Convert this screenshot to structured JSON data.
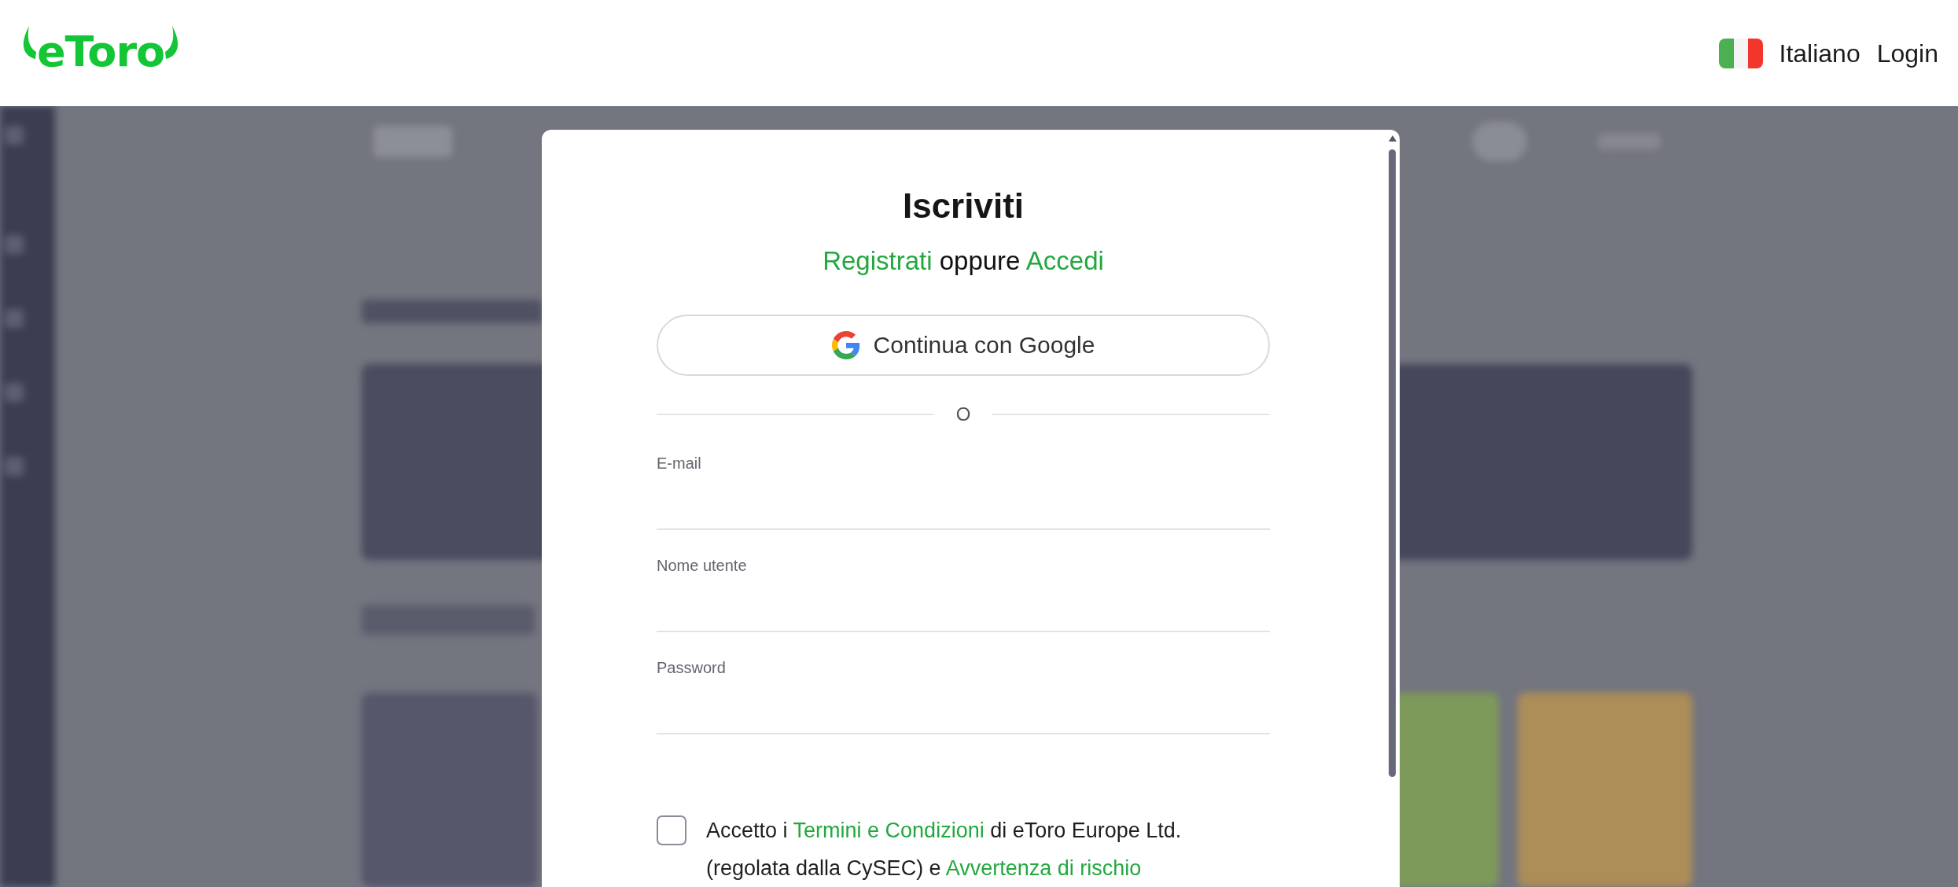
{
  "header": {
    "logo": "eToro",
    "language": "Italiano",
    "login": "Login"
  },
  "modal": {
    "title": "Iscriviti",
    "subtitle": [
      {
        "kind": "link",
        "text": "Registrati"
      },
      {
        "kind": "text",
        "text": " oppure "
      },
      {
        "kind": "link",
        "text": "Accedi"
      }
    ],
    "google_button": "Continua con Google",
    "divider": "O",
    "fields": [
      {
        "label": "E-mail"
      },
      {
        "label": "Nome utente"
      },
      {
        "label": "Password"
      }
    ],
    "consent": {
      "checked": false,
      "lines": [
        [
          {
            "kind": "text",
            "text": "Accetto i "
          },
          {
            "kind": "link",
            "text": "Termini e Condizioni"
          },
          {
            "kind": "text",
            "text": " di eToro Europe Ltd."
          }
        ],
        [
          {
            "kind": "text",
            "text": "(regolata dalla CySEC) e "
          },
          {
            "kind": "link",
            "text": "Avvertenza di rischio"
          }
        ]
      ]
    }
  }
}
